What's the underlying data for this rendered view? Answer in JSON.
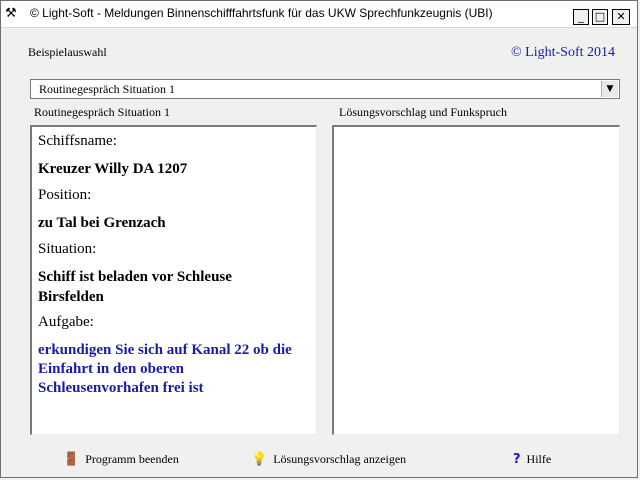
{
  "window": {
    "title": "© Light-Soft -  Meldungen Binnenschifffahrtsfunk für das UKW Sprechfunkzeugnis (UBI)",
    "minimize": "_",
    "maximize": "□",
    "close": "✕"
  },
  "header": {
    "example_label": "Beispielauswahl",
    "copyright": "© Light-Soft 2014"
  },
  "dropdown": {
    "selected": "Routinegespräch Situation 1",
    "arrow": "▼"
  },
  "left_panel": {
    "heading": "Routinegespräch Situation 1",
    "fields": [
      {
        "label": "Schiffsname:",
        "value": "Kreuzer Willy DA 1207"
      },
      {
        "label": "Position:",
        "value": "zu Tal bei Grenzach"
      },
      {
        "label": "Situation:",
        "value": "Schiff ist beladen vor Schleuse Birsfelden"
      },
      {
        "label": "Aufgabe:",
        "value": "erkundigen Sie sich auf Kanal 22 ob die Einfahrt in den oberen Schleusenvorhafen frei ist"
      }
    ]
  },
  "right_panel": {
    "heading": "Lösungsvorschlag und Funkspruch"
  },
  "footer": {
    "exit_label": "Programm beenden",
    "solution_label": "Lösungsvorschlag anzeigen",
    "help_label": "Hilfe"
  },
  "icons": {
    "app": "app-icon",
    "exit": "door-exit-icon",
    "solution": "lightbulb-icon",
    "help": "question-mark-icon"
  },
  "colors": {
    "accent": "#1a1aa8"
  }
}
